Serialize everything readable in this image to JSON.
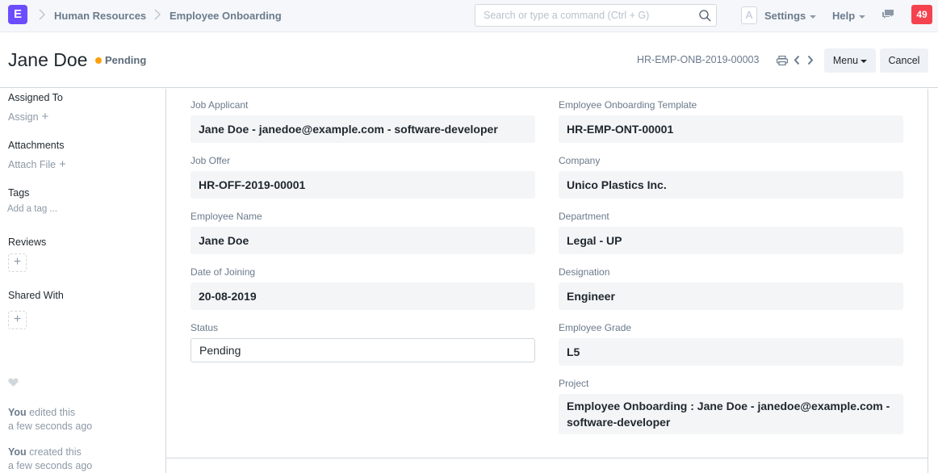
{
  "navbar": {
    "logo_letter": "E",
    "breadcrumbs": [
      "Human Resources",
      "Employee Onboarding"
    ],
    "search_placeholder": "Search or type a command (Ctrl + G)",
    "avatar_letter": "A",
    "settings_label": "Settings",
    "help_label": "Help",
    "notification_count": "49"
  },
  "page_header": {
    "title": "Jane Doe",
    "status": "Pending",
    "status_color": "#ff9f0a",
    "document_name": "HR-EMP-ONB-2019-00003",
    "menu_label": "Menu",
    "cancel_label": "Cancel"
  },
  "sidebar": {
    "assigned_to_heading": "Assigned To",
    "assign_link": "Assign",
    "attachments_heading": "Attachments",
    "attach_link": "Attach File",
    "tags_heading": "Tags",
    "add_tag_placeholder": "Add a tag ...",
    "reviews_heading": "Reviews",
    "shared_with_heading": "Shared With",
    "activity": [
      {
        "actor": "You",
        "action": "edited this",
        "time": "a few seconds ago"
      },
      {
        "actor": "You",
        "action": "created this",
        "time": "a few seconds ago"
      }
    ]
  },
  "form": {
    "left": [
      {
        "label": "Job Applicant",
        "value": "Jane Doe - janedoe@example.com - software-developer"
      },
      {
        "label": "Job Offer",
        "value": "HR-OFF-2019-00001"
      },
      {
        "label": "Employee Name",
        "value": "Jane Doe"
      },
      {
        "label": "Date of Joining",
        "value": "20-08-2019"
      },
      {
        "label": "Status",
        "value": "Pending"
      }
    ],
    "right": [
      {
        "label": "Employee Onboarding Template",
        "value": "HR-EMP-ONT-00001"
      },
      {
        "label": "Company",
        "value": "Unico Plastics Inc."
      },
      {
        "label": "Department",
        "value": "Legal - UP"
      },
      {
        "label": "Designation",
        "value": "Engineer"
      },
      {
        "label": "Employee Grade",
        "value": "L5"
      },
      {
        "label": "Project",
        "value": "Employee Onboarding : Jane Doe - janedoe@example.com - software-developer"
      }
    ]
  }
}
